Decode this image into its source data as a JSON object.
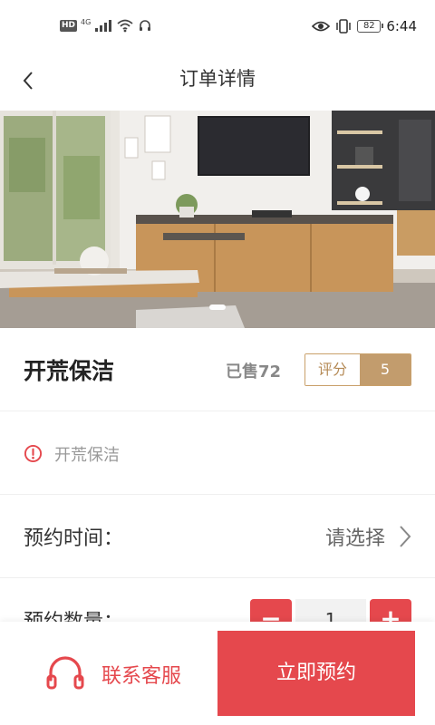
{
  "status_bar": {
    "hd": "HD",
    "network": "4G",
    "battery": "82",
    "time": "6:44"
  },
  "header": {
    "title": "订单详情",
    "back_icon": "chevron-left-icon"
  },
  "hero": {
    "alt": "living room furniture"
  },
  "product": {
    "name": "开荒保洁",
    "sold": "已售72",
    "rating_label": "评分",
    "rating_value": "5"
  },
  "notice": {
    "icon": "alert-circle-icon",
    "text": "开荒保洁"
  },
  "booking_time": {
    "label": "预约时间：",
    "value": "请选择"
  },
  "quantity": {
    "label": "预约数量：",
    "minus": "−",
    "value": "1",
    "plus": "+"
  },
  "footer": {
    "service_label": "联系客服",
    "book_label": "立即预约"
  },
  "colors": {
    "accent": "#e5484d",
    "gold": "#c29c6d"
  }
}
